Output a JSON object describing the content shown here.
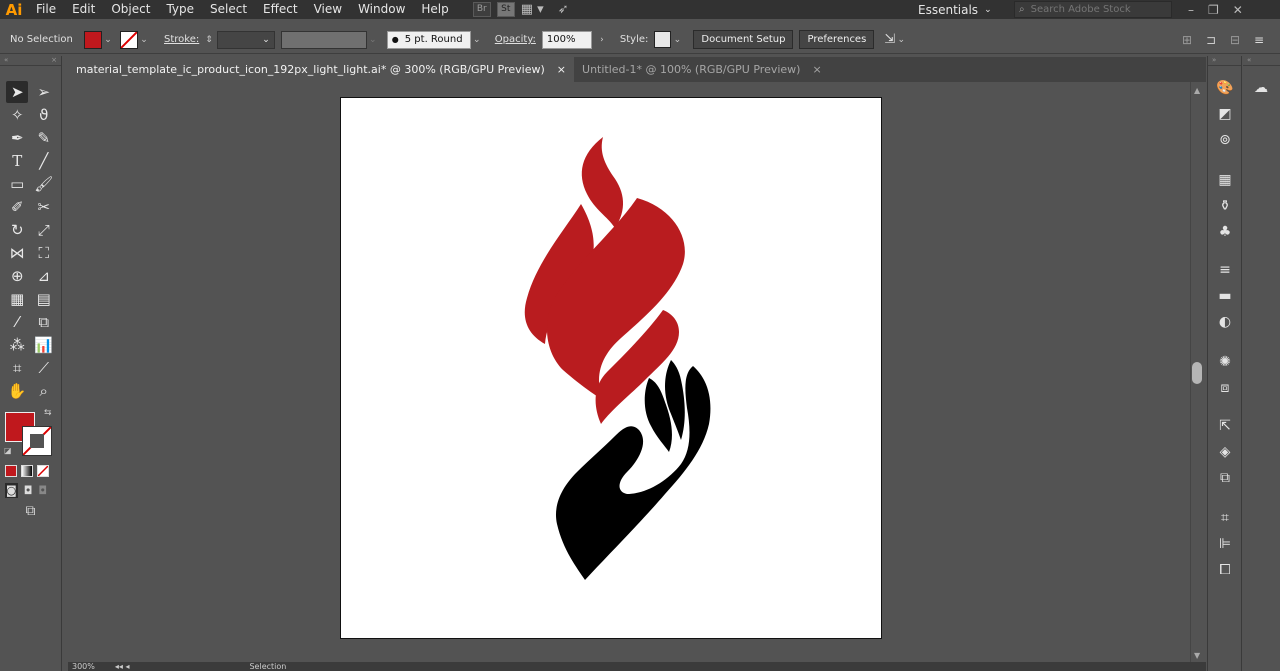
{
  "app": {
    "logo": "Ai",
    "menu": [
      "File",
      "Edit",
      "Object",
      "Type",
      "Select",
      "Effect",
      "View",
      "Window",
      "Help"
    ],
    "bridge_label": "Br",
    "stock_label": "St",
    "workspace": "Essentials",
    "search_placeholder": "Search Adobe Stock"
  },
  "control_bar": {
    "selection_status": "No Selection",
    "fill_color": "#c0181d",
    "stroke_label": "Stroke:",
    "brush_value": "5 pt. Round",
    "opacity_label": "Opacity:",
    "opacity_value": "100%",
    "style_label": "Style:",
    "document_setup_label": "Document Setup",
    "preferences_label": "Preferences"
  },
  "tabs": [
    {
      "label": "material_template_ic_product_icon_192px_light_light.ai* @ 300% (RGB/GPU Preview)",
      "close": "×"
    },
    {
      "label": "Untitled-1* @ 100% (RGB/GPU Preview)",
      "close": "×"
    }
  ],
  "artwork": {
    "flame_color": "#b91c1f",
    "hand_color": "#000000",
    "artboard_color": "#ffffff"
  },
  "toolbar": {
    "fill_swatch_color": "#c0181d"
  },
  "status": {
    "zoom": "300%",
    "tool_name": "Selection"
  }
}
